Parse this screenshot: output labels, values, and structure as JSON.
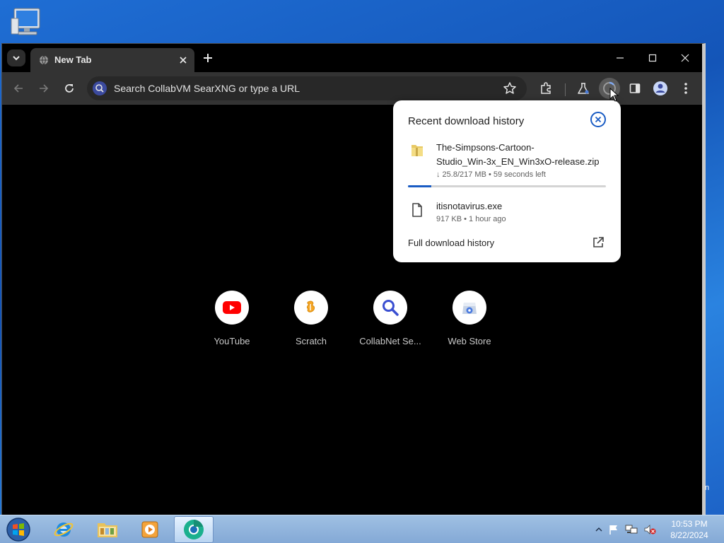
{
  "tab": {
    "title": "New Tab"
  },
  "omnibox": {
    "placeholder": "Search CollabVM SearXNG or type a URL"
  },
  "shortcuts": [
    {
      "label": "YouTube",
      "icon": "youtube-icon"
    },
    {
      "label": "Scratch",
      "icon": "scratch-icon"
    },
    {
      "label": "CollabNet Se...",
      "icon": "magnifier-icon"
    },
    {
      "label": "Web Store",
      "icon": "web-store-icon"
    }
  ],
  "downloads": {
    "title": "Recent download history",
    "items": [
      {
        "name_line1": "The-Simpsons-Cartoon-",
        "name_line2": "Studio_Win-3x_EN_Win3xO-release.zip",
        "status": "↓ 25.8/217 MB • 59 seconds left",
        "progress": 0.119,
        "icon": "zip-file-icon"
      },
      {
        "name_line1": "itisnotavirus.exe",
        "status": "917 KB • 1 hour ago",
        "icon": "file-icon"
      }
    ],
    "full_history_label": "Full download history"
  },
  "stray_text": "n",
  "taskbar": {
    "apps": [
      "internet-explorer-icon",
      "file-explorer-icon",
      "media-player-icon",
      "chromium-icon"
    ]
  },
  "clock": {
    "time": "10:53 PM",
    "date": "8/22/2024"
  },
  "colors": {
    "accent": "#1a5cc4",
    "taskbar": "#8fb3dc",
    "window_bg": "#000000"
  }
}
